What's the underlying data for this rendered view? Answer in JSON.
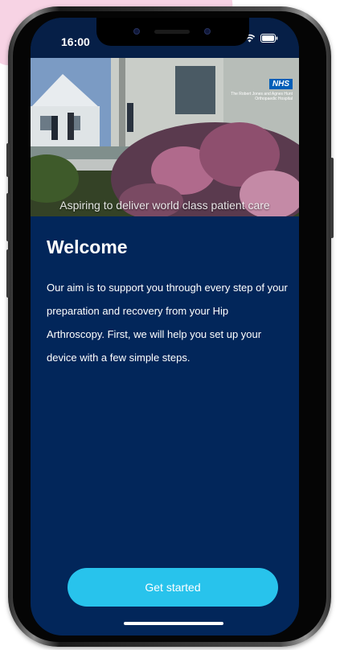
{
  "status_bar": {
    "time": "16:00",
    "icons": [
      "signal-icon",
      "wifi-icon",
      "battery-icon"
    ]
  },
  "hero": {
    "caption": "Aspiring to deliver world class patient care",
    "logo_text": "NHS",
    "logo_subtext": "The Robert Jones and Agnes Hunt Orthopaedic Hospital"
  },
  "welcome": {
    "title": "Welcome",
    "body": "Our aim is to support you through every step of your preparation and recovery from your Hip Arthroscopy. First, we will help you set up your device with a few simple steps."
  },
  "cta": {
    "label": "Get started"
  },
  "colors": {
    "screen_bg": "#02265a",
    "button_bg": "#28c3ec",
    "nhs_blue": "#005eb8"
  }
}
